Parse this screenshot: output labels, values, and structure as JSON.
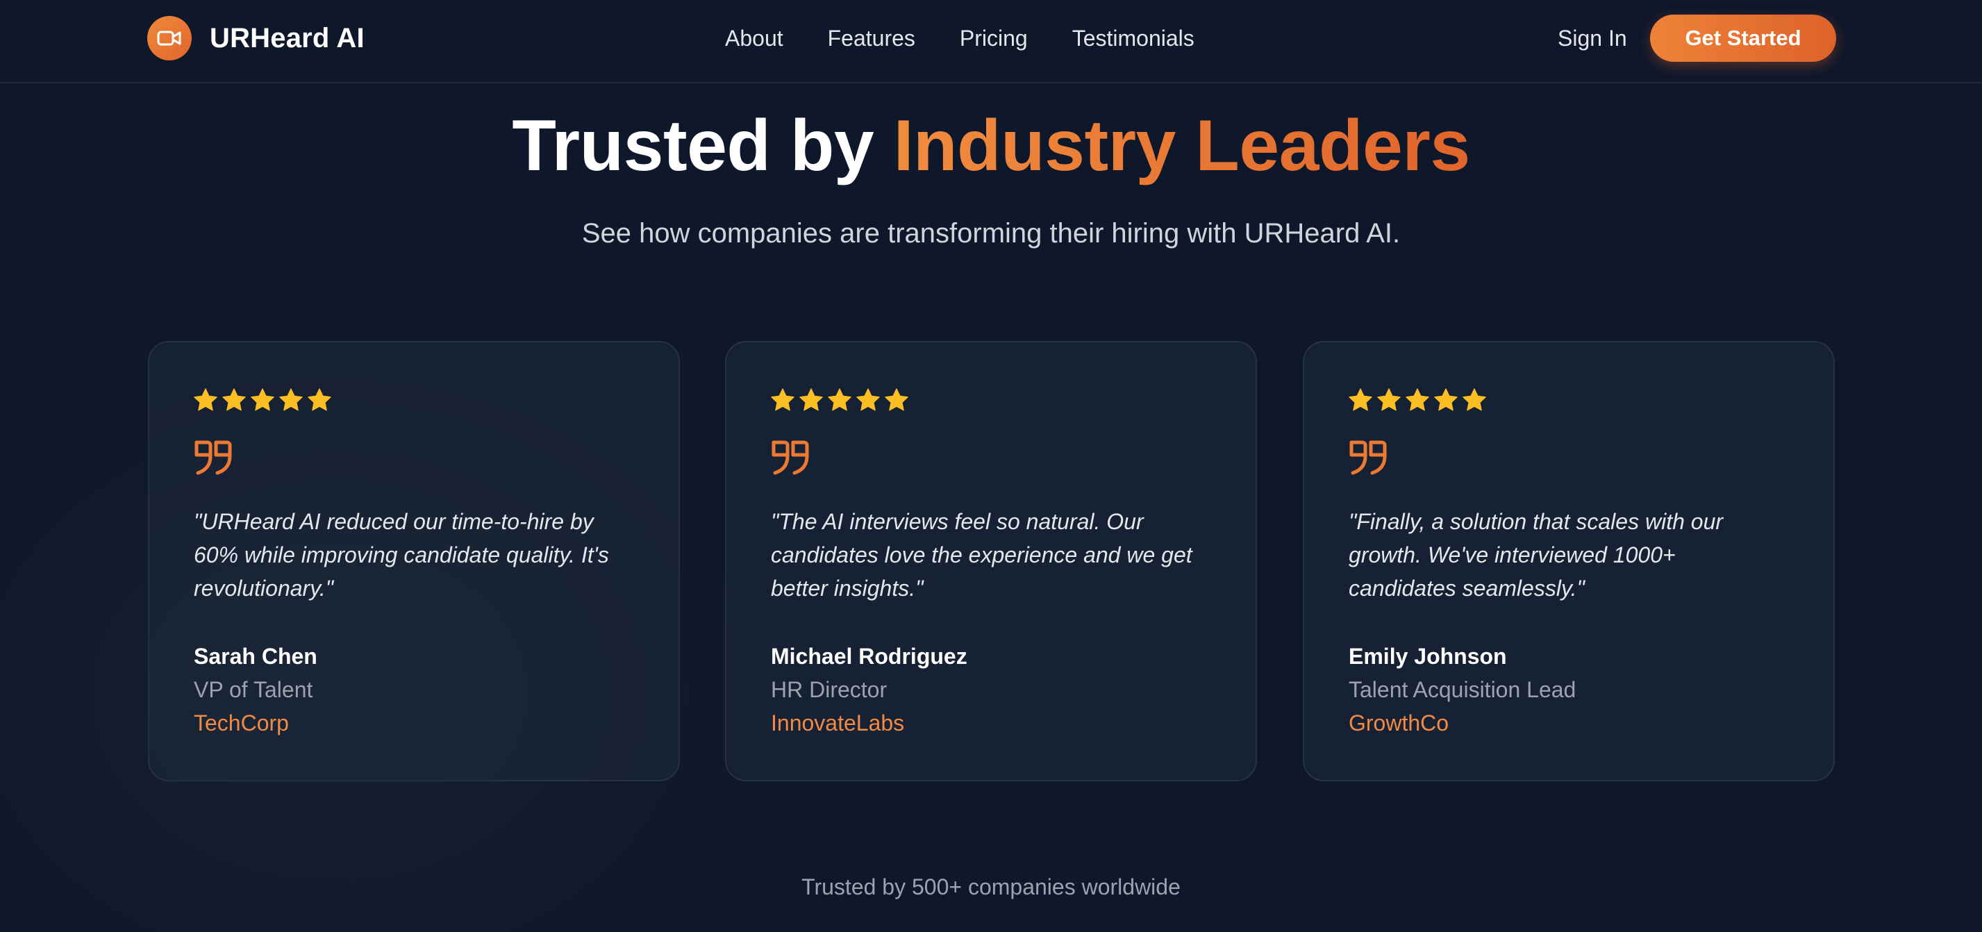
{
  "nav": {
    "brand": "URHeard AI",
    "links": [
      "About",
      "Features",
      "Pricing",
      "Testimonials"
    ],
    "sign_in": "Sign In",
    "cta": "Get Started"
  },
  "hero": {
    "title_plain": "Trusted by ",
    "title_accent": "Industry Leaders",
    "subtitle": "See how companies are transforming their hiring with URHeard AI."
  },
  "testimonials": [
    {
      "rating": 5,
      "quote": "\"URHeard AI reduced our time-to-hire by 60% while improving candidate quality. It's revolutionary.\"",
      "name": "Sarah Chen",
      "role": "VP of Talent",
      "company": "TechCorp"
    },
    {
      "rating": 5,
      "quote": "\"The AI interviews feel so natural. Our candidates love the experience and we get better insights.\"",
      "name": "Michael Rodriguez",
      "role": "HR Director",
      "company": "InnovateLabs"
    },
    {
      "rating": 5,
      "quote": "\"Finally, a solution that scales with our growth. We've interviewed 1000+ candidates seamlessly.\"",
      "name": "Emily Johnson",
      "role": "Talent Acquisition Lead",
      "company": "GrowthCo"
    }
  ],
  "footer_note": "Trusted by 500+ companies worldwide",
  "colors": {
    "accent": "#ec7a35",
    "star": "#fbbf24",
    "background": "#0f172a"
  },
  "icons": {
    "brand": "video-camera-icon",
    "star": "star-icon",
    "quote": "quote-icon"
  }
}
